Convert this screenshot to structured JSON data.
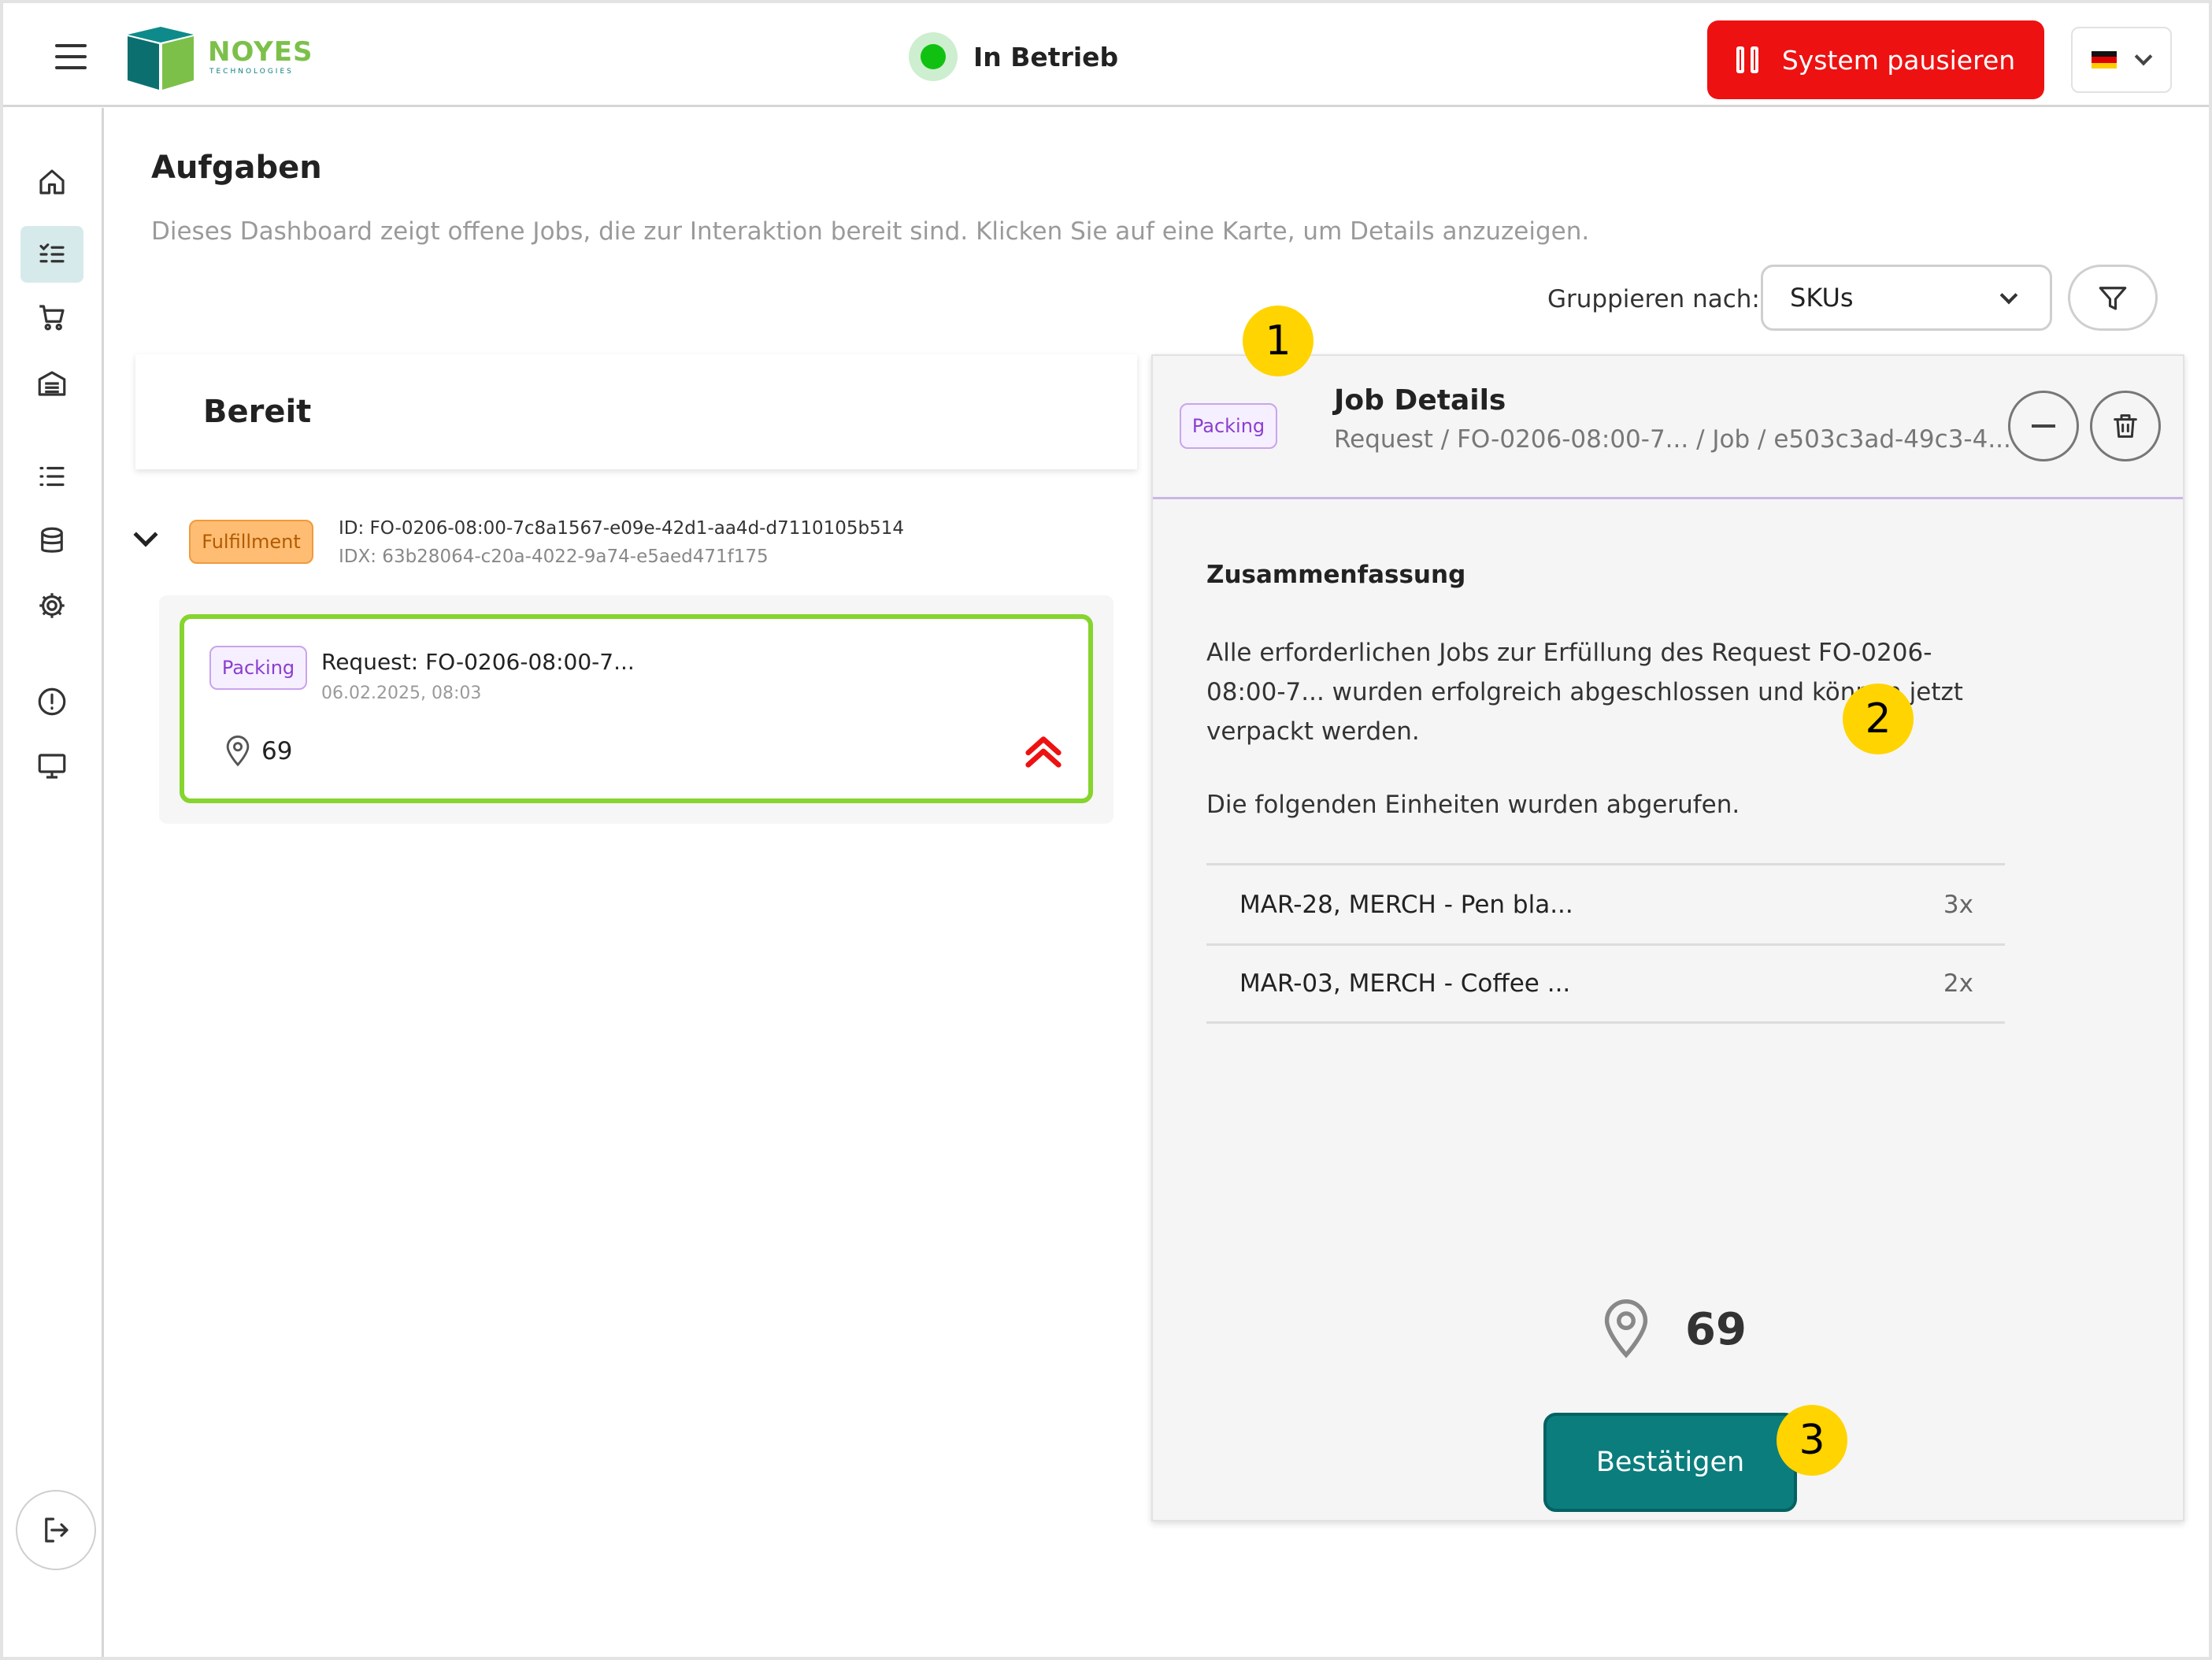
{
  "topbar": {
    "logo_brand": "NOYES",
    "logo_sub": "TECHNOLOGIES",
    "status_text": "In Betrieb",
    "pause_label": "System pausieren",
    "language": "German flag"
  },
  "sidebar": {
    "items": [
      {
        "icon": "home-icon"
      },
      {
        "icon": "task-list-icon",
        "active": true
      },
      {
        "icon": "cart-icon"
      },
      {
        "icon": "warehouse-icon"
      },
      {
        "icon": "list-icon"
      },
      {
        "icon": "database-icon"
      },
      {
        "icon": "gear-icon"
      },
      {
        "icon": "alert-icon"
      },
      {
        "icon": "monitor-icon"
      }
    ],
    "logout_icon": "logout-icon"
  },
  "page": {
    "title": "Aufgaben",
    "description": "Dieses Dashboard zeigt offene Jobs, die zur Interaktion bereit sind. Klicken Sie auf eine Karte, um Details anzuzeigen.",
    "group_label": "Gruppieren nach:",
    "group_value": "SKUs"
  },
  "column": {
    "header": "Bereit",
    "group": {
      "badge": "Fulfillment",
      "id": "ID: FO-0206-08:00-7c8a1567-e09e-42d1-aa4d-d7110105b514",
      "idx": "IDX: 63b28064-c20a-4022-9a74-e5aed471f175"
    },
    "card": {
      "badge": "Packing",
      "title": "Request: FO-0206-08:00-7...",
      "date": "06.02.2025, 08:03",
      "location": "69"
    }
  },
  "detail": {
    "badge": "Packing",
    "title": "Job Details",
    "breadcrumb": "Request / FO-0206-08:00-7... / Job / e503c3ad-49c3-4...",
    "summary_title": "Zusammenfassung",
    "summary_text": "Alle erforderlichen Jobs zur Erfüllung des Request FO-0206-08:00-7... wurden erfolgreich abgeschlossen und können jetzt verpackt werden.",
    "summary_sub": "Die folgenden Einheiten wurden abgerufen.",
    "items": [
      {
        "name": "MAR-28, MERCH - Pen bla...",
        "qty": "3x"
      },
      {
        "name": "MAR-03, MERCH - Coffee ...",
        "qty": "2x"
      }
    ],
    "location": "69",
    "confirm_label": "Bestätigen"
  },
  "markers": [
    "1",
    "2",
    "3"
  ],
  "colors": {
    "accent": "#0b7d7d",
    "danger": "#ee1111",
    "status_green": "#11c111",
    "card_border": "#86d42e",
    "packing": "#8a3fd0",
    "fulfillment": "#ffbd73",
    "marker": "#ffd400"
  }
}
